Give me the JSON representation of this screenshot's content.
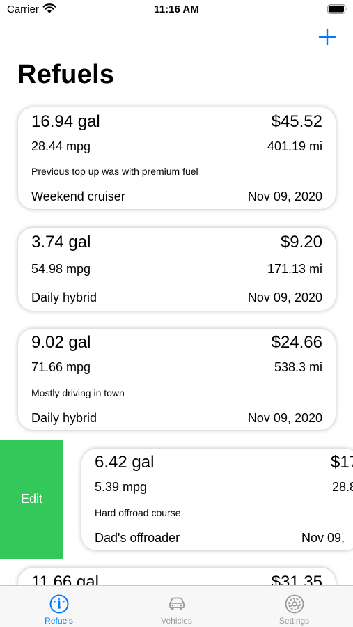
{
  "status_bar": {
    "carrier": "Carrier",
    "time": "11:16 AM"
  },
  "header": {
    "title": "Refuels",
    "add_icon": "plus-icon"
  },
  "refuels": [
    {
      "volume": "16.94 gal",
      "cost": "$45.52",
      "efficiency": "28.44 mpg",
      "distance": "401.19 mi",
      "note": "Previous top up was with premium fuel",
      "vehicle": "Weekend cruiser",
      "date": "Nov 09, 2020"
    },
    {
      "volume": "3.74 gal",
      "cost": "$9.20",
      "efficiency": "54.98 mpg",
      "distance": "171.13 mi",
      "vehicle": "Daily hybrid",
      "date": "Nov 09, 2020"
    },
    {
      "volume": "9.02 gal",
      "cost": "$24.66",
      "efficiency": "71.66 mpg",
      "distance": "538.3 mi",
      "note": "Mostly driving in town",
      "vehicle": "Daily hybrid",
      "date": "Nov 09, 2020"
    },
    {
      "volume": "6.42 gal",
      "cost": "$17",
      "efficiency": "5.39 mpg",
      "distance": "28.8",
      "note": "Hard offroad course",
      "vehicle": "Dad's offroader",
      "date": "Nov 09,"
    },
    {
      "volume": "11.66 gal",
      "cost": "$31.35"
    }
  ],
  "swipe_action": {
    "label": "Edit",
    "color": "#34c759"
  },
  "tab_bar": {
    "tabs": [
      {
        "label": "Refuels",
        "icon": "gauge-icon",
        "selected": true
      },
      {
        "label": "Vehicles",
        "icon": "car-icon",
        "selected": false
      },
      {
        "label": "Settings",
        "icon": "gear-icon",
        "selected": false
      }
    ],
    "active_color": "#007aff",
    "inactive_color": "#999999"
  }
}
